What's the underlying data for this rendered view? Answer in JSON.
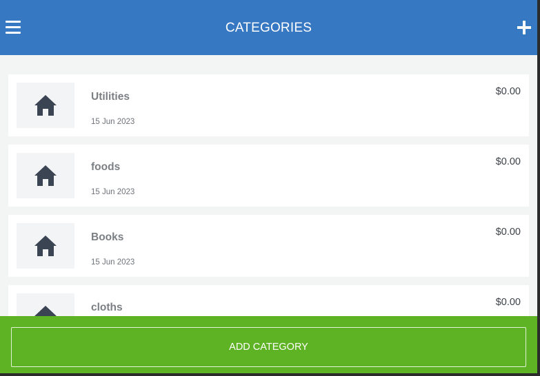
{
  "header": {
    "title": "CATEGORIES",
    "menu_icon": "hamburger-menu-icon",
    "add_icon": "plus-icon"
  },
  "categories": [
    {
      "name": "Utilities",
      "date": "15 Jun 2023",
      "amount": "$0.00",
      "icon": "house-icon"
    },
    {
      "name": "foods",
      "date": "15 Jun 2023",
      "amount": "$0.00",
      "icon": "house-icon"
    },
    {
      "name": "Books",
      "date": "15 Jun 2023",
      "amount": "$0.00",
      "icon": "house-icon"
    },
    {
      "name": "cloths",
      "amount": "$0.00",
      "icon": "house-icon"
    }
  ],
  "footer": {
    "add_category_label": "ADD CATEGORY"
  },
  "colors": {
    "header_bg": "#3778c2",
    "footer_bg": "#5eb325",
    "page_bg": "#f3f4f4",
    "icon": "#3b4452"
  }
}
